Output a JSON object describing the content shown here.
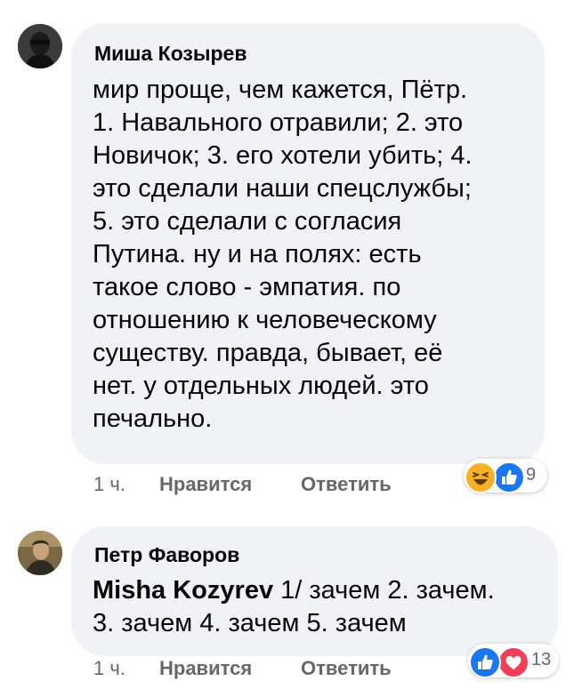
{
  "comments": [
    {
      "author": "Миша Козырев",
      "lines": [
        "мир проще, чем кажется, Пётр.",
        "1. Навального отравили; 2. это",
        "Новичок; 3. его хотели убить; 4.",
        "это сделали наши спецслужбы;",
        "5. это сделали с согласия",
        "Путина.  ну и на полях: есть",
        "такое слово - эмпатия. по",
        "отношению к человеческому",
        "существу.  правда, бывает, её",
        "нет. у отдельных людей.  это",
        "печально."
      ],
      "time": "1 ч.",
      "like_label": "Нравится",
      "reply_label": "Ответить",
      "reactions": [
        "haha",
        "like"
      ],
      "reaction_count": "9"
    },
    {
      "author": "Петр Фаворов",
      "mention": "Misha Kozyrev",
      "line1_rest": " 1/ зачем 2. зачем.",
      "line2": "3. зачем  4. зачем 5. зачем",
      "time": "1 ч.",
      "like_label": "Нравится",
      "reply_label": "Ответить",
      "reactions": [
        "like",
        "love"
      ],
      "reaction_count": "13"
    }
  ],
  "colors": {
    "bubble": "#f0f2f5",
    "meta": "#65676b",
    "like_blue": "#1877f2",
    "love_red": "#f33e58",
    "haha_yellow": "#f7b125"
  }
}
